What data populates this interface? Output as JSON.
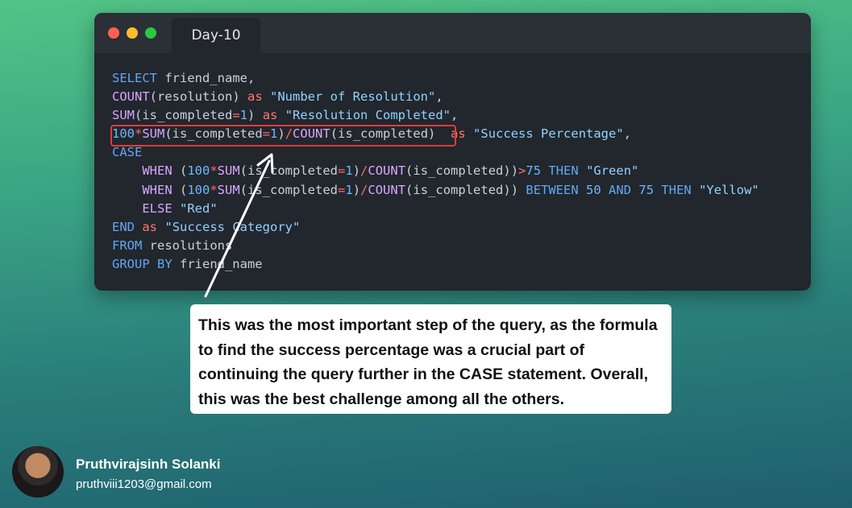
{
  "window": {
    "tab_title": "Day-10",
    "traffic_lights": [
      "close",
      "minimize",
      "maximize"
    ]
  },
  "code": {
    "lines": [
      [
        {
          "t": "SELECT",
          "c": "kw"
        },
        {
          "t": " friend_name,",
          "c": "plain"
        }
      ],
      [
        {
          "t": "COUNT",
          "c": "fn"
        },
        {
          "t": "(resolution) ",
          "c": "plain"
        },
        {
          "t": "as",
          "c": "as"
        },
        {
          "t": " ",
          "c": "plain"
        },
        {
          "t": "\"Number of Resolution\"",
          "c": "str"
        },
        {
          "t": ",",
          "c": "plain"
        }
      ],
      [
        {
          "t": "SUM",
          "c": "fn"
        },
        {
          "t": "(is_completed",
          "c": "plain"
        },
        {
          "t": "=",
          "c": "op"
        },
        {
          "t": "1",
          "c": "num"
        },
        {
          "t": ") ",
          "c": "plain"
        },
        {
          "t": "as",
          "c": "as"
        },
        {
          "t": " ",
          "c": "plain"
        },
        {
          "t": "\"Resolution Completed\"",
          "c": "str"
        },
        {
          "t": ",",
          "c": "plain"
        }
      ],
      [
        {
          "t": "100",
          "c": "num"
        },
        {
          "t": "*",
          "c": "op"
        },
        {
          "t": "SUM",
          "c": "fn"
        },
        {
          "t": "(is_completed",
          "c": "plain"
        },
        {
          "t": "=",
          "c": "op"
        },
        {
          "t": "1",
          "c": "num"
        },
        {
          "t": ")",
          "c": "plain"
        },
        {
          "t": "/",
          "c": "op"
        },
        {
          "t": "COUNT",
          "c": "fn"
        },
        {
          "t": "(is_completed)  ",
          "c": "plain"
        },
        {
          "t": "as",
          "c": "as"
        },
        {
          "t": " ",
          "c": "plain"
        },
        {
          "t": "\"Success Percentage\"",
          "c": "str"
        },
        {
          "t": ",",
          "c": "plain"
        }
      ],
      [
        {
          "t": "CASE",
          "c": "kw"
        }
      ],
      [
        {
          "t": "    ",
          "c": "plain"
        },
        {
          "t": "WHEN",
          "c": "fn"
        },
        {
          "t": " (",
          "c": "plain"
        },
        {
          "t": "100",
          "c": "num"
        },
        {
          "t": "*",
          "c": "op"
        },
        {
          "t": "SUM",
          "c": "fn"
        },
        {
          "t": "(is_completed",
          "c": "plain"
        },
        {
          "t": "=",
          "c": "op"
        },
        {
          "t": "1",
          "c": "num"
        },
        {
          "t": ")",
          "c": "plain"
        },
        {
          "t": "/",
          "c": "op"
        },
        {
          "t": "COUNT",
          "c": "fn"
        },
        {
          "t": "(is_completed))",
          "c": "plain"
        },
        {
          "t": ">",
          "c": "op"
        },
        {
          "t": "75",
          "c": "num"
        },
        {
          "t": " ",
          "c": "plain"
        },
        {
          "t": "THEN",
          "c": "kw"
        },
        {
          "t": " ",
          "c": "plain"
        },
        {
          "t": "\"Green\"",
          "c": "str"
        }
      ],
      [
        {
          "t": "    ",
          "c": "plain"
        },
        {
          "t": "WHEN",
          "c": "fn"
        },
        {
          "t": " (",
          "c": "plain"
        },
        {
          "t": "100",
          "c": "num"
        },
        {
          "t": "*",
          "c": "op"
        },
        {
          "t": "SUM",
          "c": "fn"
        },
        {
          "t": "(is_completed",
          "c": "plain"
        },
        {
          "t": "=",
          "c": "op"
        },
        {
          "t": "1",
          "c": "num"
        },
        {
          "t": ")",
          "c": "plain"
        },
        {
          "t": "/",
          "c": "op"
        },
        {
          "t": "COUNT",
          "c": "fn"
        },
        {
          "t": "(is_completed)) ",
          "c": "plain"
        },
        {
          "t": "BETWEEN",
          "c": "kw"
        },
        {
          "t": " ",
          "c": "plain"
        },
        {
          "t": "50",
          "c": "num"
        },
        {
          "t": " ",
          "c": "plain"
        },
        {
          "t": "AND",
          "c": "kw"
        },
        {
          "t": " ",
          "c": "plain"
        },
        {
          "t": "75",
          "c": "num"
        },
        {
          "t": " ",
          "c": "plain"
        },
        {
          "t": "THEN",
          "c": "kw"
        },
        {
          "t": " ",
          "c": "plain"
        },
        {
          "t": "\"Yellow\"",
          "c": "str"
        }
      ],
      [
        {
          "t": "    ",
          "c": "plain"
        },
        {
          "t": "ELSE",
          "c": "fn"
        },
        {
          "t": " ",
          "c": "plain"
        },
        {
          "t": "\"Red\"",
          "c": "str"
        }
      ],
      [
        {
          "t": "END",
          "c": "kw"
        },
        {
          "t": " ",
          "c": "plain"
        },
        {
          "t": "as",
          "c": "as"
        },
        {
          "t": " ",
          "c": "plain"
        },
        {
          "t": "\"Success Category\"",
          "c": "str"
        }
      ],
      [
        {
          "t": "FROM",
          "c": "kw"
        },
        {
          "t": " resolutions",
          "c": "plain"
        }
      ],
      [
        {
          "t": "GROUP BY",
          "c": "kw"
        },
        {
          "t": " friend_name",
          "c": "plain"
        }
      ]
    ]
  },
  "callout": {
    "text": "This was the most important step of the query, as the formula to find the success percentage was a crucial part of continuing the query further in the CASE statement. Overall, this was the best challenge among all the others."
  },
  "author": {
    "name": "Pruthvirajsinh Solanki",
    "email": "pruthviii1203@gmail.com"
  },
  "colors": {
    "highlight_border": "#e23b3b",
    "editor_bg": "#22262d",
    "keyword": "#5fa8f5",
    "function": "#d7a6ff",
    "string": "#8fd3ff",
    "operator": "#ff6b6b"
  }
}
